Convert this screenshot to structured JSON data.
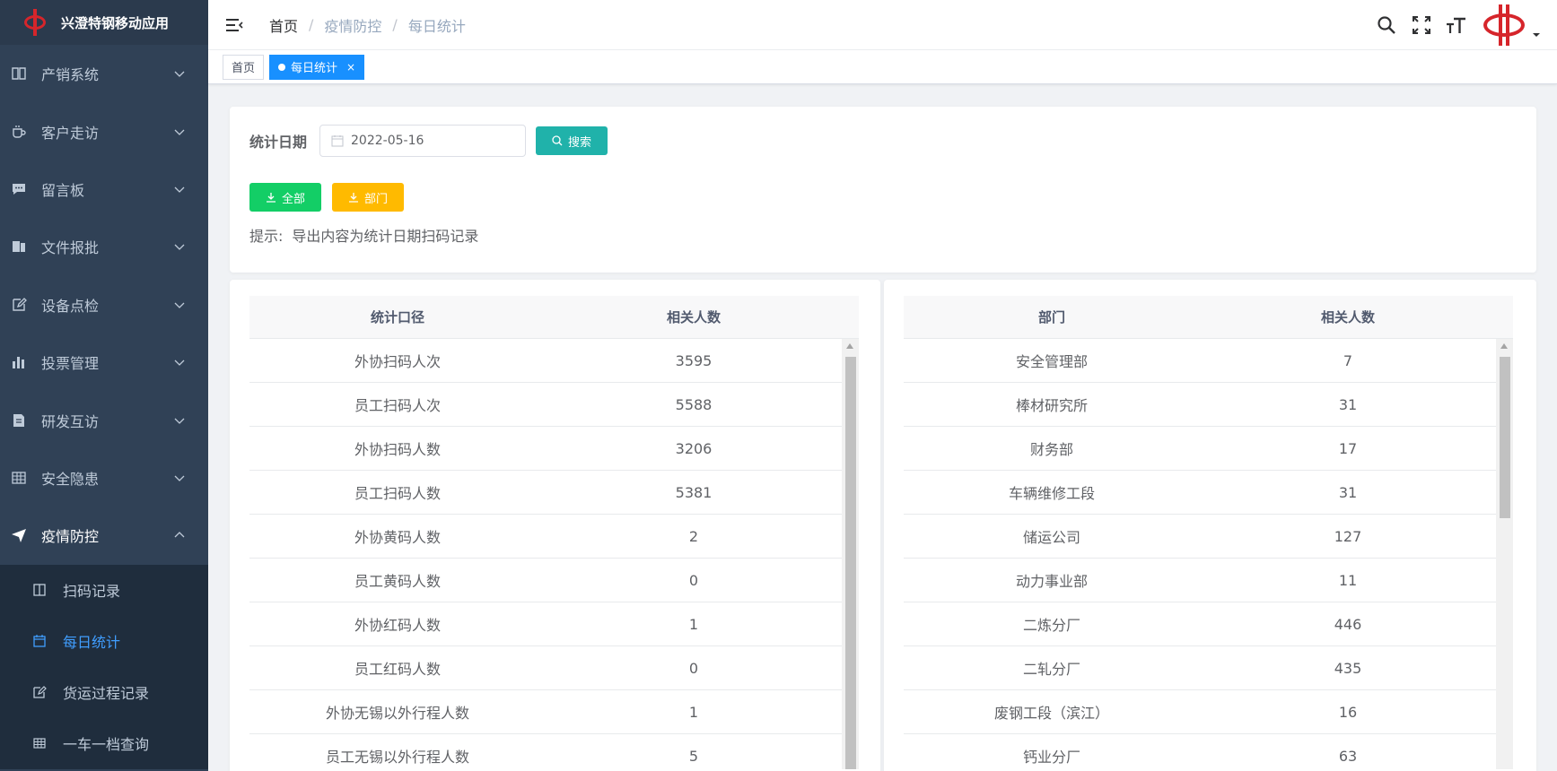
{
  "app": {
    "title": "兴澄特钢移动应用"
  },
  "sidebar": {
    "items": [
      {
        "label": "产销系统",
        "icon": "book-icon"
      },
      {
        "label": "客户走访",
        "icon": "coffee-icon"
      },
      {
        "label": "留言板",
        "icon": "message-icon"
      },
      {
        "label": "文件报批",
        "icon": "documents-icon"
      },
      {
        "label": "设备点检",
        "icon": "edit-icon"
      },
      {
        "label": "投票管理",
        "icon": "chart-icon"
      },
      {
        "label": "研发互访",
        "icon": "file-icon"
      },
      {
        "label": "安全隐患",
        "icon": "grid-icon"
      },
      {
        "label": "疫情防控",
        "icon": "send-icon"
      }
    ],
    "submenu": [
      {
        "label": "扫码记录",
        "icon": "book-icon"
      },
      {
        "label": "每日统计",
        "icon": "calendar-icon"
      },
      {
        "label": "货运过程记录",
        "icon": "edit-icon"
      },
      {
        "label": "一车一档查询",
        "icon": "grid-icon"
      }
    ]
  },
  "navbar": {
    "breadcrumb": [
      "首页",
      "疫情防控",
      "每日统计"
    ]
  },
  "tags": {
    "home": "首页",
    "current": "每日统计",
    "close": "×"
  },
  "filter": {
    "date_label": "统计日期",
    "date_value": "2022-05-16",
    "search_label": "搜索",
    "export_all_label": "全部",
    "export_dept_label": "部门",
    "hint_label": "提示:",
    "hint_text": "导出内容为统计日期扫码记录"
  },
  "left_table": {
    "headers": [
      "统计口径",
      "相关人数"
    ],
    "rows": [
      [
        "外协扫码人次",
        "3595"
      ],
      [
        "员工扫码人次",
        "5588"
      ],
      [
        "外协扫码人数",
        "3206"
      ],
      [
        "员工扫码人数",
        "5381"
      ],
      [
        "外协黄码人数",
        "2"
      ],
      [
        "员工黄码人数",
        "0"
      ],
      [
        "外协红码人数",
        "1"
      ],
      [
        "员工红码人数",
        "0"
      ],
      [
        "外协无锡以外行程人数",
        "1"
      ],
      [
        "员工无锡以外行程人数",
        "5"
      ]
    ]
  },
  "right_table": {
    "headers": [
      "部门",
      "相关人数"
    ],
    "rows": [
      [
        "安全管理部",
        "7"
      ],
      [
        "棒材研究所",
        "31"
      ],
      [
        "财务部",
        "17"
      ],
      [
        "车辆维修工段",
        "31"
      ],
      [
        "储运公司",
        "127"
      ],
      [
        "动力事业部",
        "11"
      ],
      [
        "二炼分厂",
        "446"
      ],
      [
        "二轧分厂",
        "435"
      ],
      [
        "废钢工段（滨江）",
        "16"
      ],
      [
        "钙业分厂",
        "63"
      ]
    ]
  },
  "colors": {
    "sidebar_bg": "#304156",
    "active_blue": "#1890ff",
    "search_teal": "#20b2aa",
    "export_green": "#13ce66",
    "export_yellow": "#ffba00",
    "brand_red": "#d6252b"
  }
}
